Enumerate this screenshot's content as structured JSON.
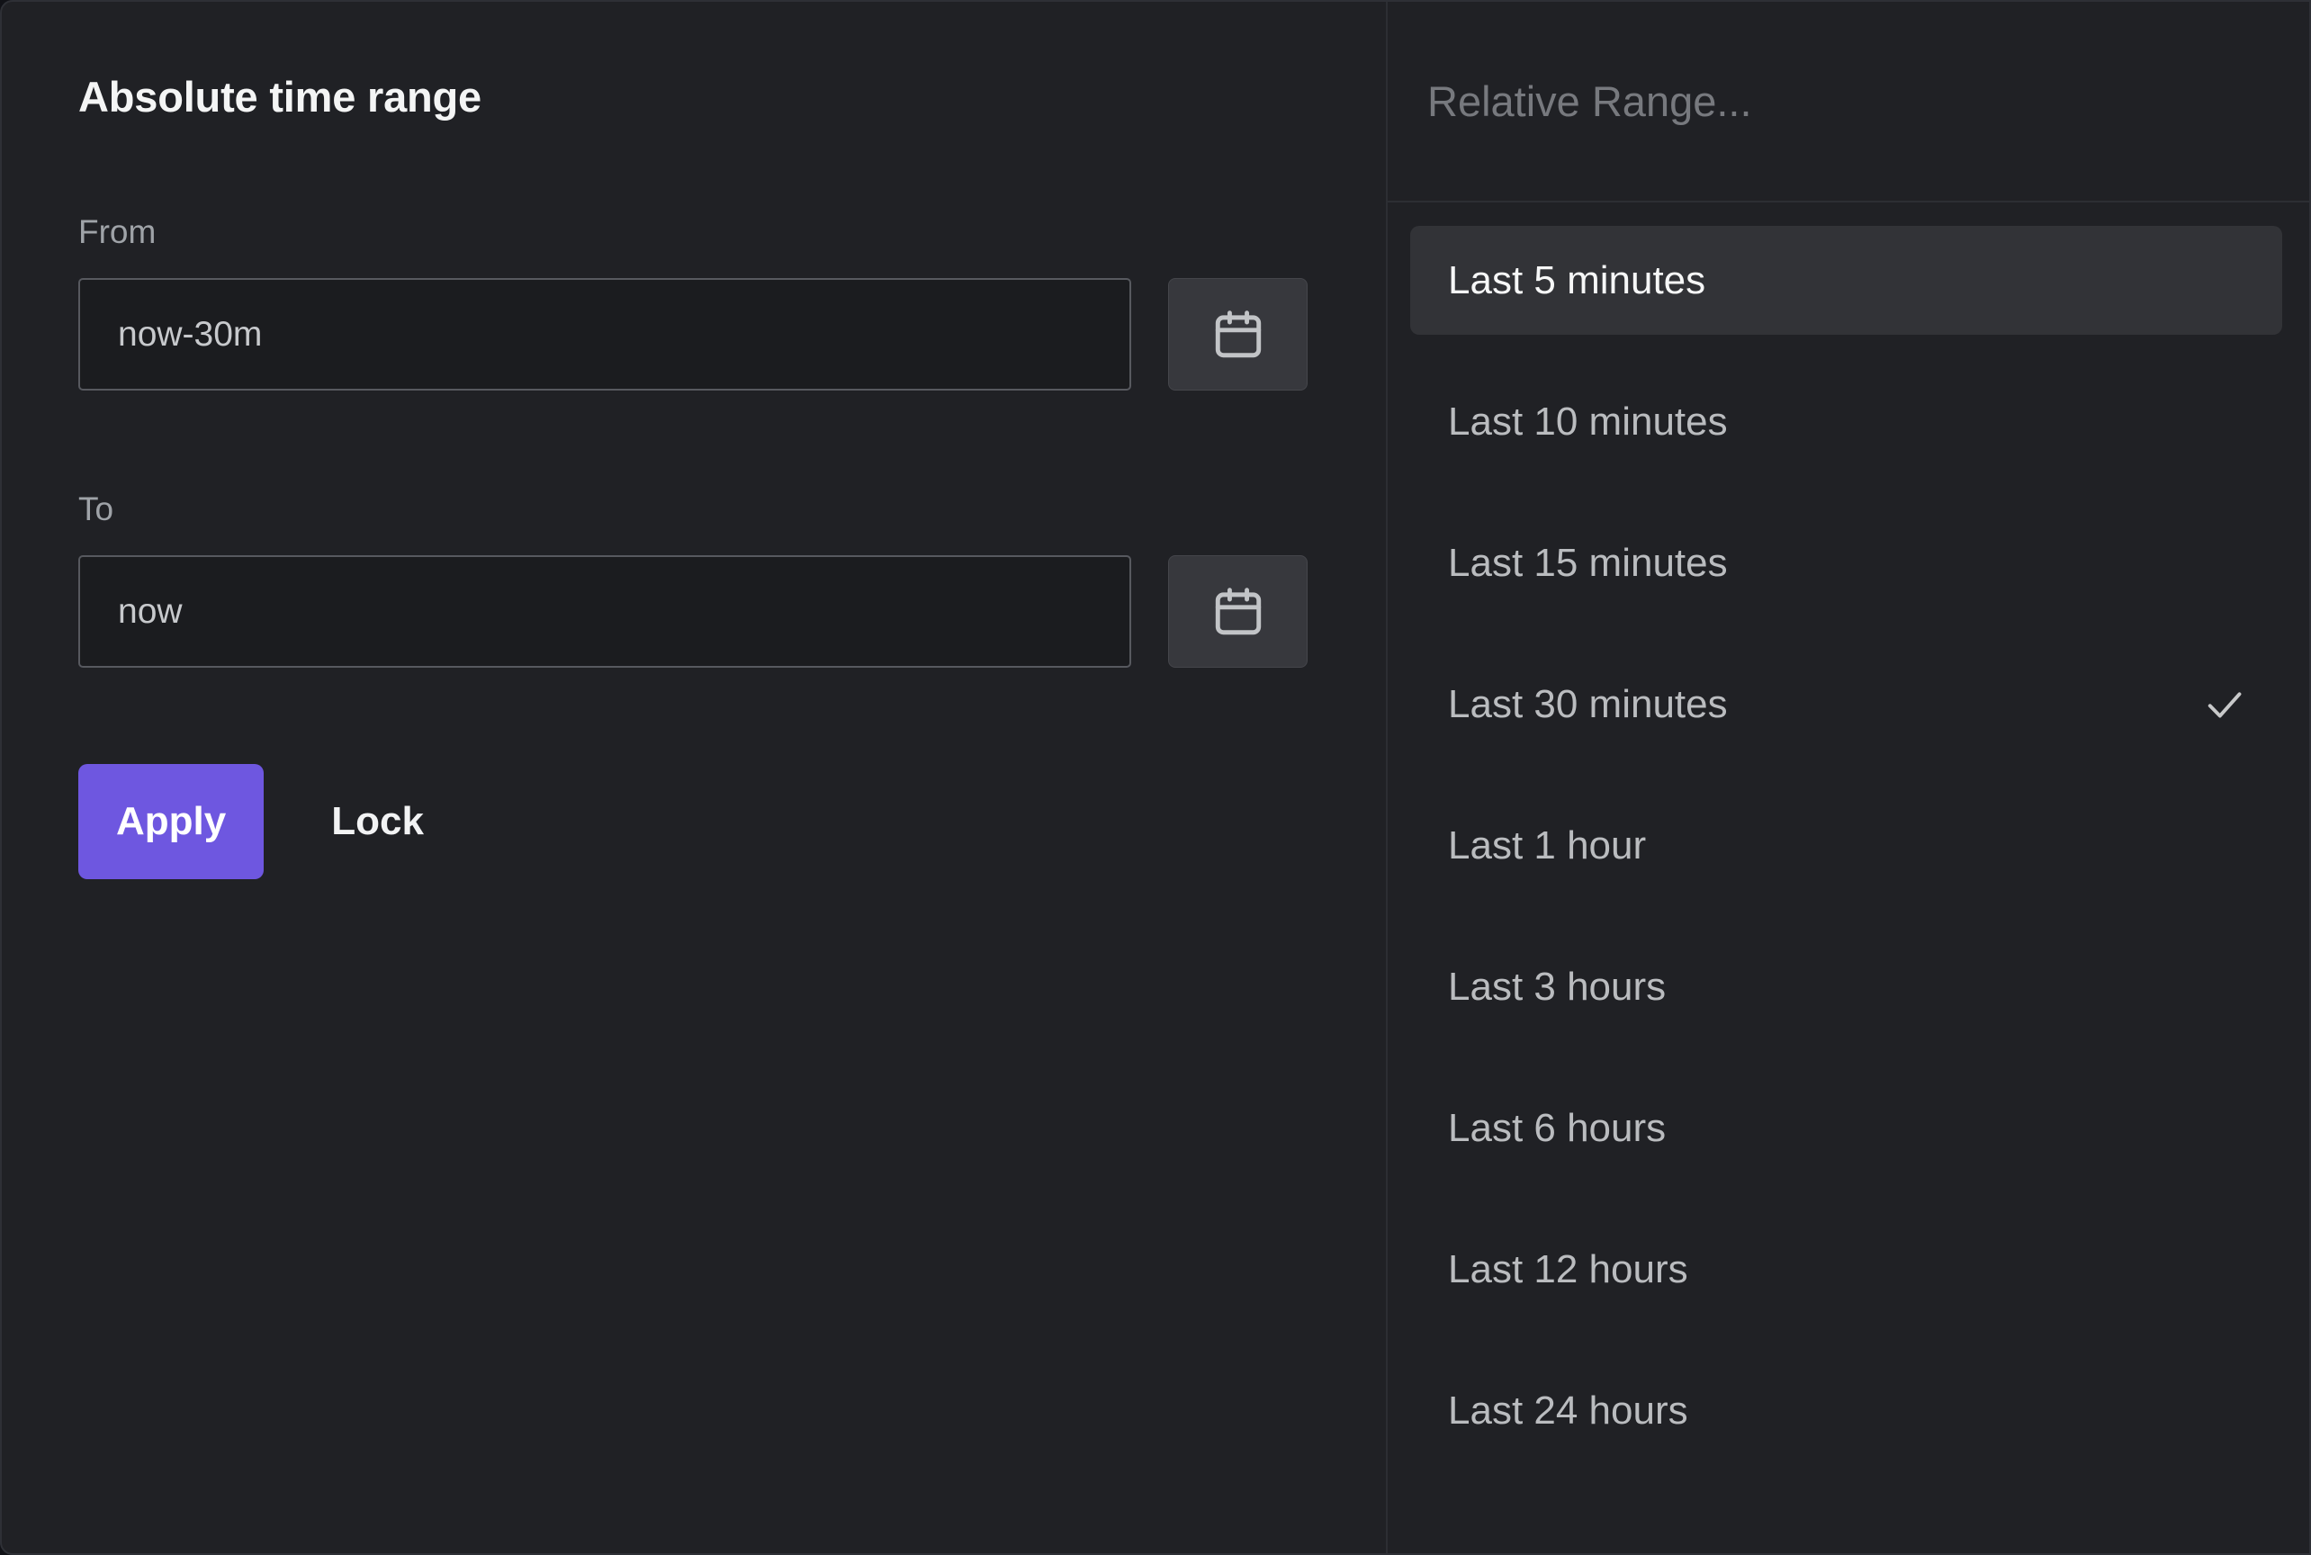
{
  "absolute": {
    "title": "Absolute time range",
    "from": {
      "label": "From",
      "value": "now-30m",
      "placeholder": "now-30m",
      "calendar_icon": "calendar-icon"
    },
    "to": {
      "label": "To",
      "value": "now",
      "placeholder": "now",
      "calendar_icon": "calendar-icon"
    },
    "apply_label": "Apply",
    "lock_label": "Lock"
  },
  "relative": {
    "search_placeholder": "Relative Range...",
    "search_value": "",
    "items": [
      {
        "label": "Last 5 minutes",
        "highlighted": true,
        "selected": false
      },
      {
        "label": "Last 10 minutes",
        "highlighted": false,
        "selected": false
      },
      {
        "label": "Last 15 minutes",
        "highlighted": false,
        "selected": false
      },
      {
        "label": "Last 30 minutes",
        "highlighted": false,
        "selected": true
      },
      {
        "label": "Last 1 hour",
        "highlighted": false,
        "selected": false
      },
      {
        "label": "Last 3 hours",
        "highlighted": false,
        "selected": false
      },
      {
        "label": "Last 6 hours",
        "highlighted": false,
        "selected": false
      },
      {
        "label": "Last 12 hours",
        "highlighted": false,
        "selected": false
      },
      {
        "label": "Last 24 hours",
        "highlighted": false,
        "selected": false
      }
    ],
    "check_icon": "check-icon"
  },
  "colors": {
    "background": "#202125",
    "panel_border": "#2c2e33",
    "accent": "#6e57e0",
    "input_background": "#1b1c1f",
    "input_border": "#57595f",
    "highlight_background": "#323337",
    "text_primary": "#f4f5f5",
    "text_secondary": "#babcbf",
    "text_muted": "#77797e"
  }
}
